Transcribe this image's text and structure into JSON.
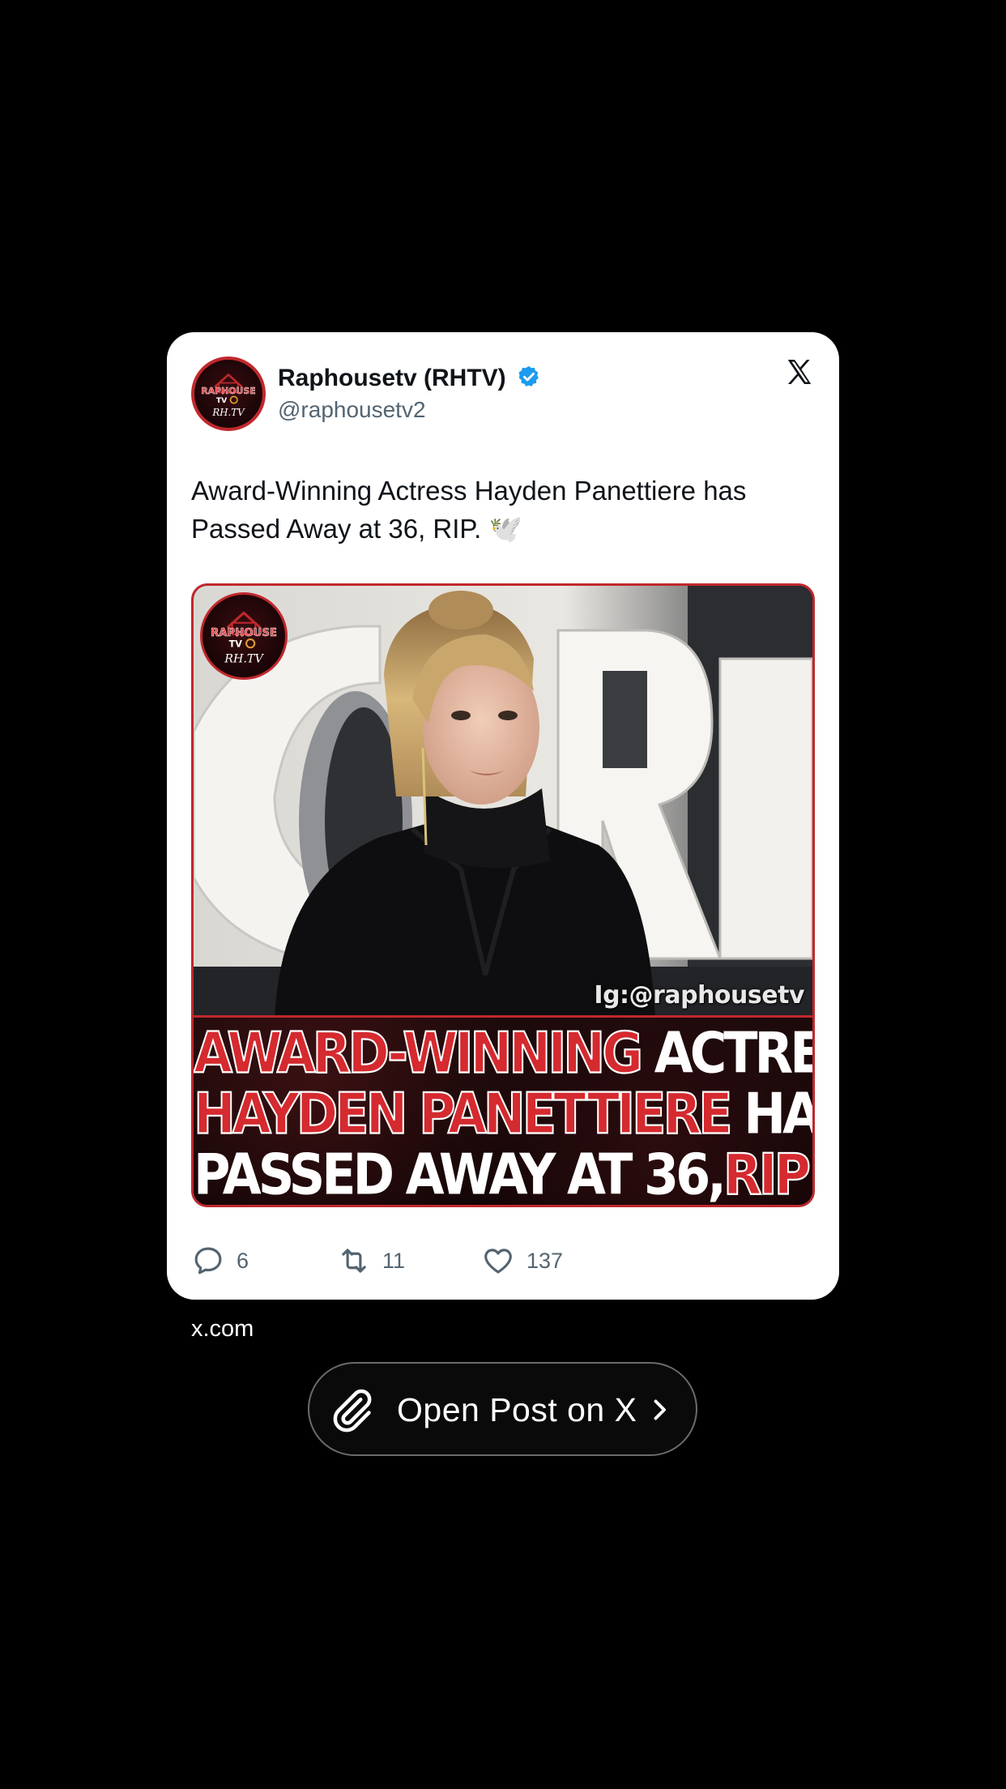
{
  "tweet": {
    "author_name": "Raphousetv (RHTV)",
    "handle": "@raphousetv2",
    "text": "Award-Winning Actress Hayden Panettiere has Passed Away at 36, RIP. 🕊️",
    "avatar_icon": "raphouse-tv-logo",
    "verified_icon": "verified-badge-icon",
    "platform_icon": "x-logo-icon",
    "media": {
      "logo_text_top": "RAPHOUSE",
      "logo_text_mid": "TV",
      "logo_text_bottom": "RH.TV",
      "watermark": "Ig:@raphousetv",
      "headline": {
        "l1_red": "AWARD-WINNING",
        "l1_white": " ACTRESS",
        "l2_red": "HAYDEN PANETTIERE",
        "l2_white": " HAS",
        "l3_white": "PASSED AWAY AT 36,",
        "l3_red": "RIP",
        "l3_emoji": "🙏🏾"
      }
    },
    "stats": {
      "replies": "6",
      "reposts": "11",
      "likes": "137"
    }
  },
  "footer": {
    "domain": "x.com",
    "open_button_label": "Open Post on X"
  },
  "colors": {
    "background": "#000000",
    "card": "#ffffff",
    "verified_blue": "#1d9bf0",
    "brand_red": "#d52a2f",
    "muted_text": "#536471"
  }
}
